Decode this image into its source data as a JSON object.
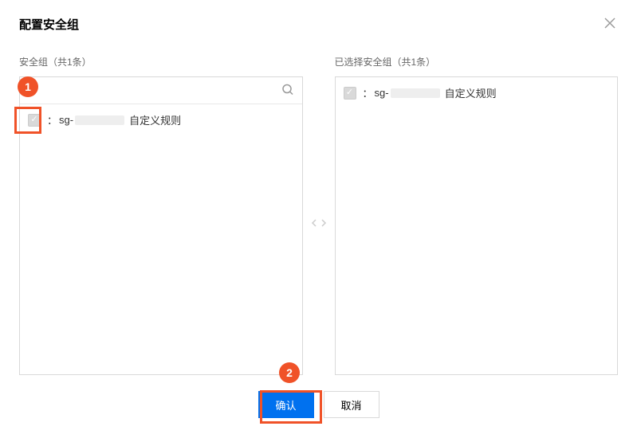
{
  "dialog": {
    "title": "配置安全组"
  },
  "leftPanel": {
    "label": "安全组（共1条）",
    "searchPlaceholder": "",
    "items": [
      {
        "colon": "：",
        "prefix": "sg-",
        "suffix": "自定义规则"
      }
    ]
  },
  "rightPanel": {
    "label": "已选择安全组（共1条）",
    "items": [
      {
        "colon": "：",
        "prefix": "sg-",
        "suffix": "自定义规则"
      }
    ]
  },
  "buttons": {
    "confirm": "确认",
    "cancel": "取消"
  },
  "annotations": {
    "badge1": "1",
    "badge2": "2"
  }
}
